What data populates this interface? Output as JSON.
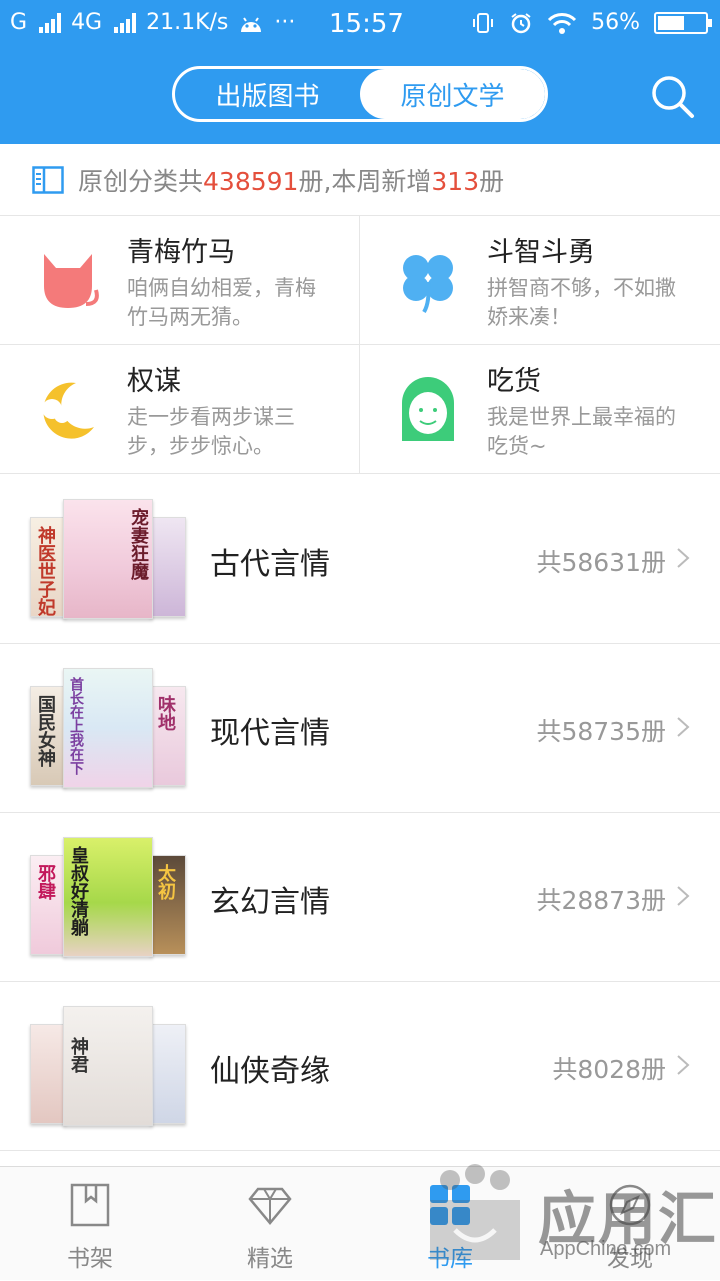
{
  "status_bar": {
    "carrier1": "G",
    "carrier2": "4G",
    "speed": "21.1K/s",
    "more": "···",
    "time": "15:57",
    "battery_percent": "56%",
    "battery_level": 0.56
  },
  "header": {
    "tabs": [
      {
        "label": "出版图书",
        "active": false
      },
      {
        "label": "原创文学",
        "active": true
      }
    ],
    "search_icon": "search-icon"
  },
  "summary": {
    "prefix": "原创分类共",
    "total": "438591",
    "middle": "册,本周新增",
    "new_count": "313",
    "suffix": "册"
  },
  "themes": [
    {
      "title": "青梅竹马",
      "desc": "咱俩自幼相爱，青梅竹马两无猜。",
      "icon": "cat-icon",
      "color": "#f47a7a"
    },
    {
      "title": "斗智斗勇",
      "desc": "拼智商不够，不如撒娇来凑！",
      "icon": "clover-icon",
      "color": "#4fb0f2"
    },
    {
      "title": "权谋",
      "desc": "走一步看两步谋三步，步步惊心。",
      "icon": "moon-icon",
      "color": "#f5c12c"
    },
    {
      "title": "吃货",
      "desc": "我是世界上最幸福的吃货~",
      "icon": "girl-face-icon",
      "color": "#3dcc7a"
    }
  ],
  "categories": [
    {
      "name": "古代言情",
      "count": "共58631册",
      "covers": [
        "神医世子妃",
        "宠妻狂魔",
        ""
      ]
    },
    {
      "name": "现代言情",
      "count": "共58735册",
      "covers": [
        "国民女神",
        "首长在上我在下",
        "味地"
      ]
    },
    {
      "name": "玄幻言情",
      "count": "共28873册",
      "covers": [
        "邪肆",
        "皇叔好清躺",
        "太初"
      ]
    },
    {
      "name": "仙侠奇缘",
      "count": "共8028册",
      "covers": [
        "",
        "神君",
        ""
      ]
    }
  ],
  "bottom_nav": [
    {
      "label": "书架",
      "icon": "bookmark-book-icon",
      "active": false
    },
    {
      "label": "精选",
      "icon": "diamond-icon",
      "active": false
    },
    {
      "label": "书库",
      "icon": "library-grid-icon",
      "active": true
    },
    {
      "label": "发现",
      "icon": "compass-icon",
      "active": false
    }
  ],
  "watermark": {
    "text": "应用汇",
    "sub": "AppChina.com"
  },
  "colors": {
    "primary": "#2f9bf0",
    "highlight": "#e44f3c"
  }
}
